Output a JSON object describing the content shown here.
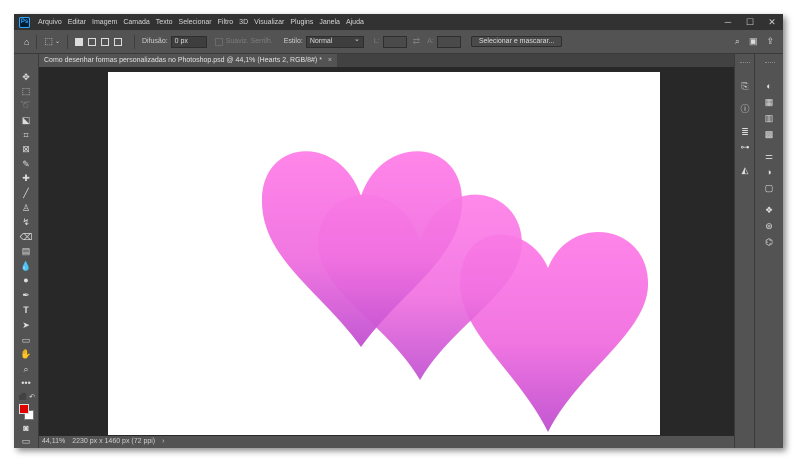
{
  "app": {
    "logo": "Ps",
    "menu": [
      "Arquivo",
      "Editar",
      "Imagem",
      "Camada",
      "Texto",
      "Selecionar",
      "Filtro",
      "3D",
      "Visualizar",
      "Plugins",
      "Janela",
      "Ajuda"
    ],
    "window_controls": [
      "minimize-icon",
      "maximize-icon",
      "close-icon"
    ]
  },
  "options_bar": {
    "tool_icon": "marquee-icon",
    "feather_label": "Difusão:",
    "feather_value": "0 px",
    "antialias_label": "Suaviz. Serrilh.",
    "style_label": "Estilo:",
    "style_value": "Normal",
    "width_label": "L:",
    "height_label": "A:",
    "mask_button": "Selecionar e mascarar..."
  },
  "document": {
    "tab_title": "Como desenhar formas personalizadas no Photoshop.psd @ 44,1% (Hearts 2, RGB/8#) *",
    "close": "×",
    "heart_gradient": {
      "top": "#ff7fe8",
      "bottom": "#c050d0"
    }
  },
  "status": {
    "zoom": "44,11%",
    "dimensions": "2230 px x 1460 px (72 ppi)",
    "more": "›"
  },
  "colors": {
    "foreground": "#e00000",
    "background": "#ffffff",
    "accent": "#31a8ff"
  }
}
